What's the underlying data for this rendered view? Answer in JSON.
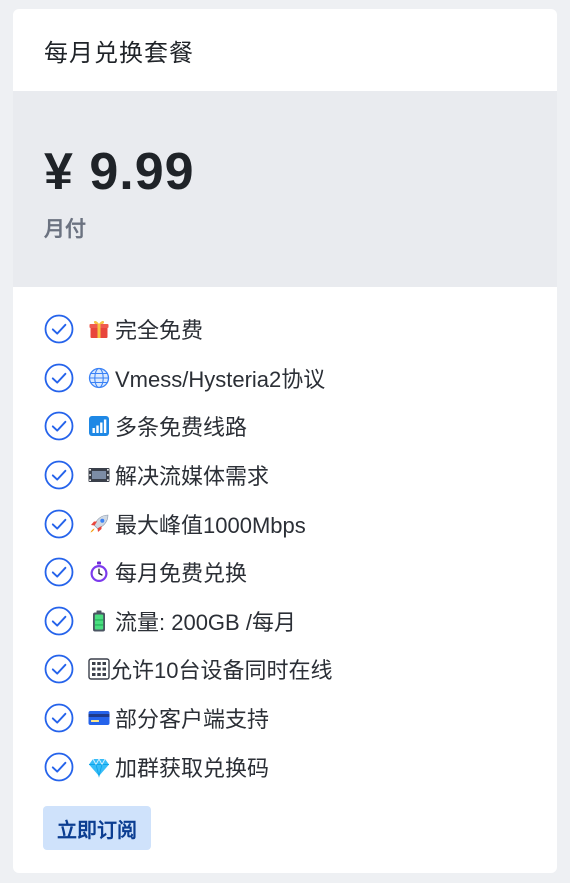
{
  "plan": {
    "title": "每月兑换套餐",
    "price": "¥ 9.99",
    "period": "月付",
    "accent_color": "#2563eb",
    "button_bg": "#cfe2fb",
    "button_text_color": "#0b3d91"
  },
  "features": [
    {
      "icon": "gift-icon",
      "text": "完全免费"
    },
    {
      "icon": "globe-icon",
      "text": "Vmess/Hysteria2协议"
    },
    {
      "icon": "signal-bars-icon",
      "text": "多条免费线路"
    },
    {
      "icon": "film-icon",
      "text": "解决流媒体需求"
    },
    {
      "icon": "rocket-icon",
      "text": "最大峰值1000Mbps"
    },
    {
      "icon": "stopwatch-icon",
      "text": "每月免费兑换"
    },
    {
      "icon": "battery-icon",
      "text": "流量: 200GB /每月"
    },
    {
      "icon": "keypad-icon",
      "text": "允许10台设备同时在线"
    },
    {
      "icon": "credit-card-icon",
      "text": "部分客户端支持"
    },
    {
      "icon": "gem-icon",
      "text": "加群获取兑换码"
    }
  ],
  "actions": {
    "subscribe_label": "立即订阅"
  }
}
